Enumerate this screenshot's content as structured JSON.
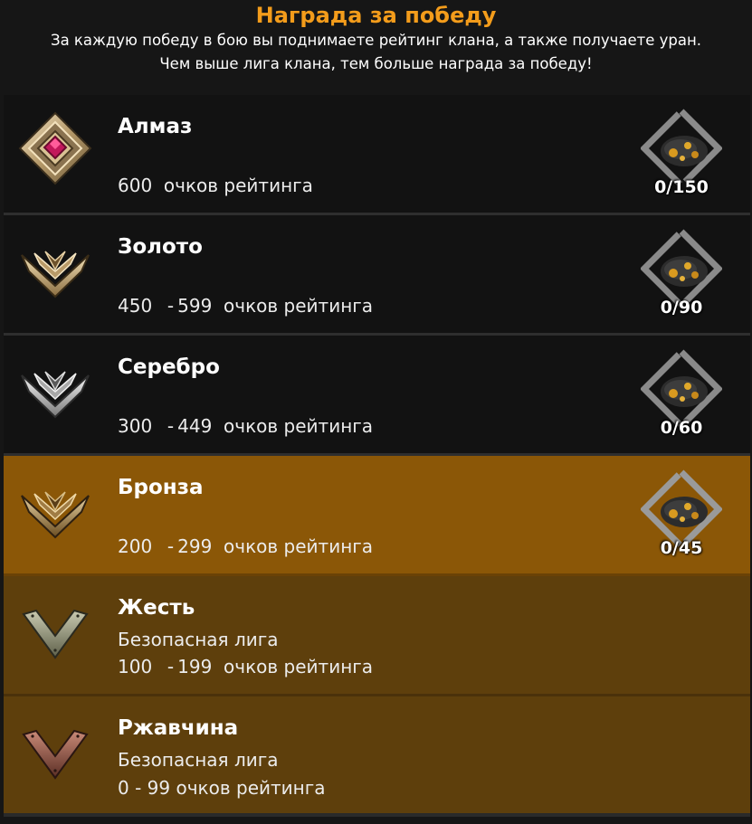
{
  "header": {
    "title": "Награда за победу",
    "line1": "За каждую победу в бою вы поднимаете рейтинг клана, а также получаете уран.",
    "line2": "Чем выше лига клана, тем больше награда за победу!"
  },
  "leagues": [
    {
      "name": "Алмаз",
      "subtitle": "",
      "rating_from": "600",
      "rating_to": "",
      "rating_suffix": "очков рейтинга",
      "reward": "0/150",
      "icon": "diamond-league-icon",
      "state": "locked"
    },
    {
      "name": "Золото",
      "subtitle": "",
      "rating_from": "450",
      "rating_to": "599",
      "rating_suffix": "очков рейтинга",
      "reward": "0/90",
      "icon": "gold-league-icon",
      "state": "locked"
    },
    {
      "name": "Серебро",
      "subtitle": "",
      "rating_from": "300",
      "rating_to": "449",
      "rating_suffix": "очков рейтинга",
      "reward": "0/60",
      "icon": "silver-league-icon",
      "state": "locked"
    },
    {
      "name": "Бронза",
      "subtitle": "",
      "rating_from": "200",
      "rating_to": "299",
      "rating_suffix": "очков рейтинга",
      "reward": "0/45",
      "icon": "bronze-league-icon",
      "state": "current"
    },
    {
      "name": "Жесть",
      "subtitle": "Безопасная лига",
      "rating_from": "100",
      "rating_to": "199",
      "rating_suffix": "очков рейтинга",
      "reward": "",
      "icon": "tin-league-icon",
      "state": "safe"
    },
    {
      "name": "Ржавчина",
      "subtitle": "Безопасная лига",
      "rating_from": "0",
      "rating_to": "99",
      "rating_suffix": "очков рейтинга",
      "reward": "",
      "icon": "rust-league-icon",
      "state": "safe"
    }
  ],
  "colors": {
    "title": "#f39c1b",
    "current_row": "#8b5707",
    "safe_row": "#5e3f0c",
    "background": "#121212"
  }
}
